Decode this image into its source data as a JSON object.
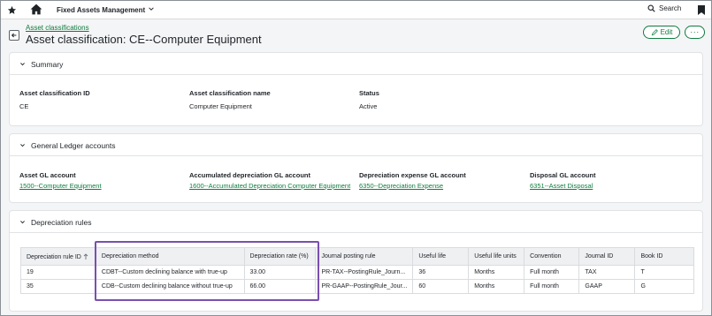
{
  "topbar": {
    "app_name": "Fixed Assets Management",
    "search_label": "Search"
  },
  "header": {
    "breadcrumb": "Asset classifications",
    "title": "Asset classification: CE--Computer Equipment",
    "edit_label": "Edit",
    "more_label": "···"
  },
  "summary": {
    "title": "Summary",
    "fields": [
      {
        "label": "Asset classification ID",
        "value": "CE"
      },
      {
        "label": "Asset classification name",
        "value": "Computer Equipment"
      },
      {
        "label": "Status",
        "value": "Active"
      }
    ]
  },
  "gl": {
    "title": "General Ledger accounts",
    "fields": [
      {
        "label": "Asset GL account",
        "value": "1500--Computer Equipment"
      },
      {
        "label": "Accumulated depreciation GL account",
        "value": "1600--Accumulated Depreciation Computer Equipment"
      },
      {
        "label": "Depreciation expense GL account",
        "value": "6350--Depreciation Expense"
      },
      {
        "label": "Disposal GL account",
        "value": "6351--Asset Disposal"
      }
    ]
  },
  "rules": {
    "title": "Depreciation rules",
    "columns": [
      "Depreciation rule ID",
      "Depreciation method",
      "Depreciation rate (%)",
      "Journal posting rule",
      "Useful life",
      "Useful life units",
      "Convention",
      "Journal ID",
      "Book ID"
    ],
    "rows": [
      [
        "19",
        "CDBT--Custom declining balance with true-up",
        "33.00",
        "PR-TAX--PostingRule_Journ...",
        "36",
        "Months",
        "Full month",
        "TAX",
        "T"
      ],
      [
        "35",
        "CDB--Custom declining balance without true-up",
        "66.00",
        "PR-GAAP--PostingRule_Jour...",
        "60",
        "Months",
        "Full month",
        "GAAP",
        "G"
      ]
    ]
  },
  "colors": {
    "accent_green": "#0f7b3f",
    "highlight_purple": "#7a4fb0"
  }
}
